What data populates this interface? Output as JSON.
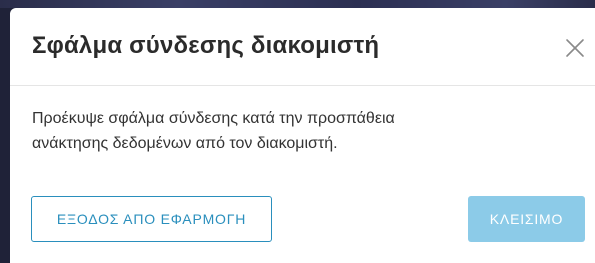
{
  "dialog": {
    "title": "Σφάλμα σύνδεσης διακομιστή",
    "close_icon": "close-icon",
    "message_line1": "Προέκυψε σφάλμα σύνδεσης κατά την προσπάθεια",
    "message_line2": "ανάκτησης δεδομένων από τον διακομιστή.",
    "exit_button_label": "ΕΞΟΔΟΣ ΑΠΟ ΕΦΑΡΜΟΓΗ",
    "close_button_label": "ΚΛΕΙΣΙΜΟ"
  },
  "colors": {
    "primary": "#2a8fbd",
    "primary_light": "#8ccbe8",
    "backdrop": "#1f2238"
  }
}
